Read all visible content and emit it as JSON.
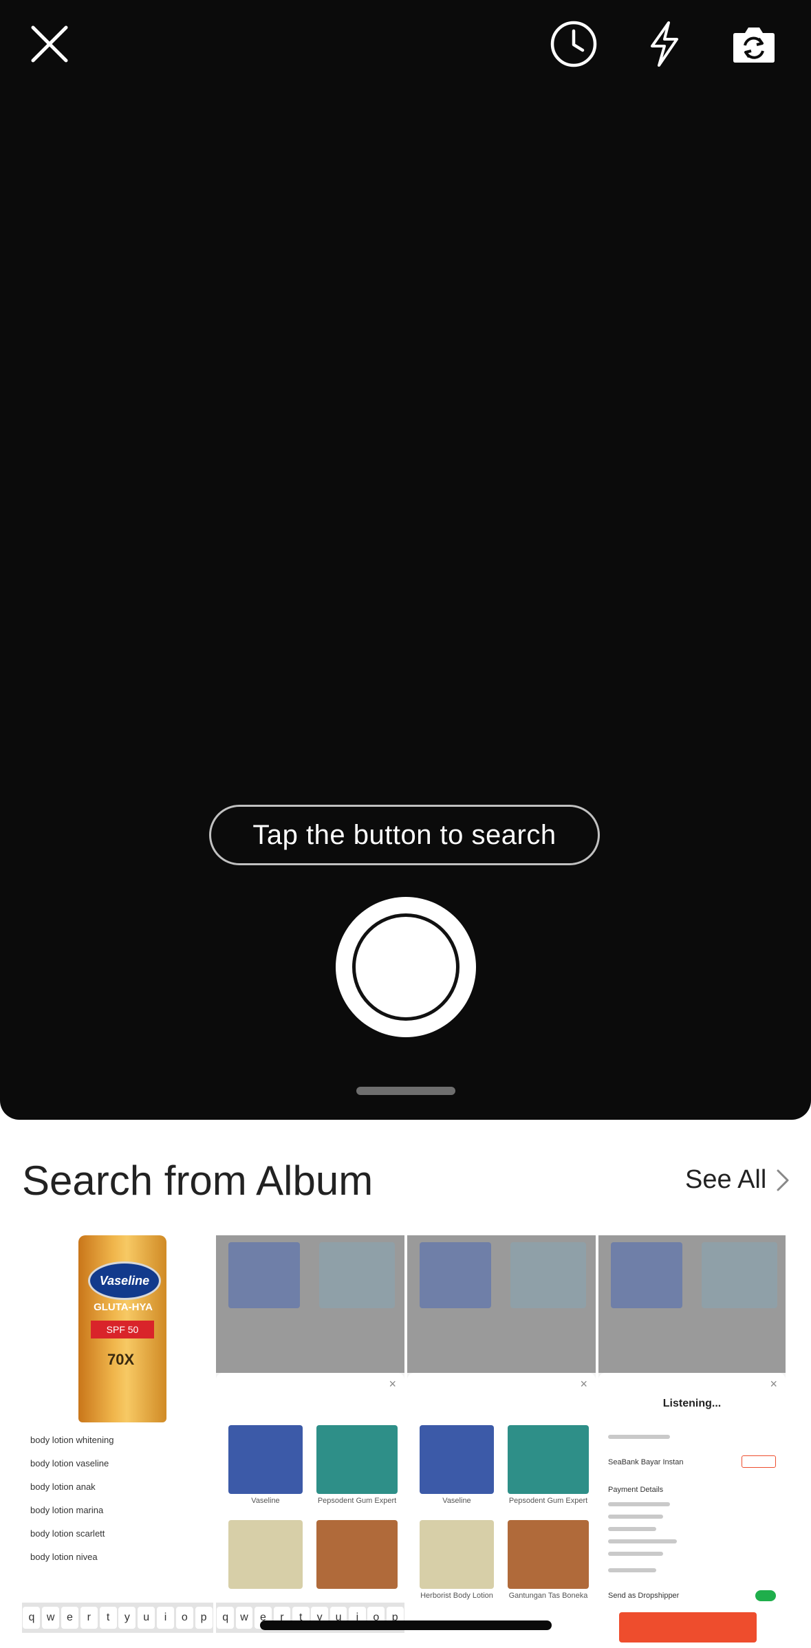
{
  "camera": {
    "hint": "Tap the button to search"
  },
  "album": {
    "title": "Search from Album",
    "see_all": "See All"
  },
  "thumb1": {
    "brand": "Vaseline",
    "subtitle": "GLUTA-HYA",
    "spf": "SPF 50",
    "badge": "70X",
    "suggestions": [
      "body lotion whitening",
      "body lotion vaseline",
      "body lotion anak",
      "body lotion marina",
      "body lotion scarlett",
      "body lotion nivea"
    ],
    "keys": [
      "q",
      "w",
      "e",
      "r",
      "t",
      "y",
      "u",
      "i",
      "o",
      "p"
    ]
  },
  "thumb2": {
    "label_left": "Vaseline",
    "label_right": "Pepsodent Gum Expert",
    "keys": [
      "q",
      "w",
      "e",
      "r",
      "t",
      "y",
      "u",
      "i",
      "o",
      "p"
    ]
  },
  "thumb3": {
    "label_left": "Vaseline",
    "label_right": "Pepsodent Gum Expert",
    "label_left2": "Herborist Body Lotion",
    "label_right2": "Gantungan Tas Boneka"
  },
  "thumb4": {
    "listening": "Listening...",
    "payment_title": "Payment Details",
    "seabank": "SeaBank Bayar Instan",
    "dropshipper": "Send as Dropshipper"
  },
  "colors": {
    "camera_bg": "#0b0b0b",
    "accent_green": "#1fae4b",
    "accent_orange": "#ee4d2d"
  }
}
